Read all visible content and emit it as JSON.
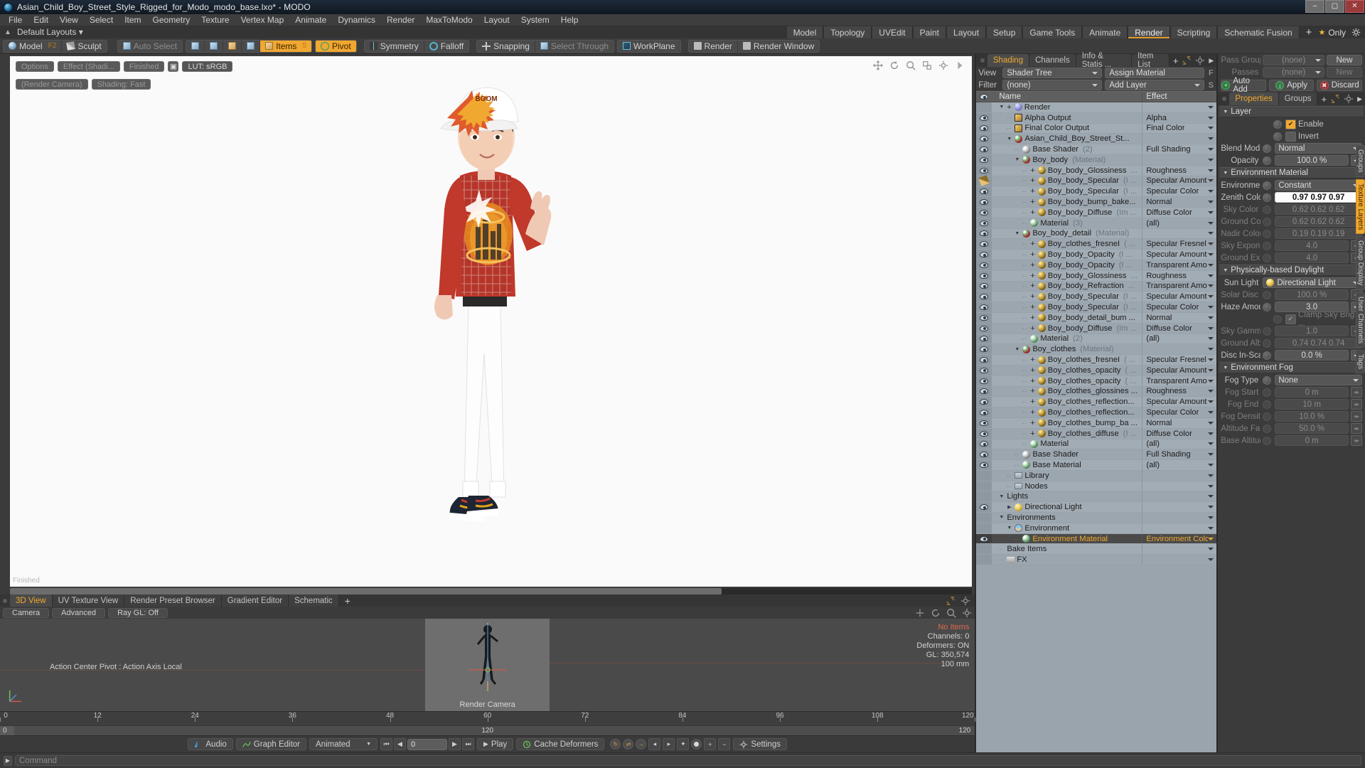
{
  "window": {
    "title": "Asian_Child_Boy_Street_Style_Rigged_for_Modo_modo_base.lxo* - MODO",
    "app_icon": "modo-logo-icon",
    "minimize": "–",
    "maximize": "▢",
    "close": "✕"
  },
  "menu": [
    "File",
    "Edit",
    "View",
    "Select",
    "Item",
    "Geometry",
    "Texture",
    "Vertex Map",
    "Animate",
    "Dynamics",
    "Render",
    "MaxToModo",
    "Layout",
    "System",
    "Help"
  ],
  "layout_row": {
    "pin_icon": "pin-icon",
    "layouts_label": "Default Layouts",
    "tabs": [
      "Model",
      "Topology",
      "UVEdit",
      "Paint",
      "Layout",
      "Setup",
      "Game Tools",
      "Animate",
      "Render",
      "Scripting",
      "Schematic Fusion"
    ],
    "active_tab": "Render",
    "add_tab": "+",
    "only_label": "Only",
    "gear_icon": "gear-icon",
    "star_icon": "star-icon"
  },
  "modebar": {
    "model_label": "Model",
    "model_key": "F2",
    "sculpt_label": "Sculpt",
    "auto_select": "Auto Select",
    "component_icons": [
      "vertex-icon",
      "edge-icon",
      "polygon-icon",
      "item-icon"
    ],
    "items_label": "Items",
    "items_count": "5",
    "pivot_label": "Pivot",
    "symmetry_label": "Symmetry",
    "falloff_label": "Falloff",
    "snapping_label": "Snapping",
    "select_through_label": "Select Through",
    "workplane_label": "WorkPlane",
    "render_label": "Render",
    "render_window_label": "Render Window"
  },
  "viewport": {
    "chips": [
      "Options",
      "Effect (Shadi...",
      "Finished"
    ],
    "lut_label": "LUT: sRGB",
    "camera_label": "(Render Camera)",
    "shading_label": "Shading: Fast",
    "status_left": "Finished",
    "status_right": "",
    "tool_icons": [
      "pan-icon",
      "rotate-icon",
      "zoom-icon",
      "fit-icon",
      "gear-icon",
      "expand-icon"
    ]
  },
  "left_tabs": {
    "items": [
      "3D View",
      "UV Texture View",
      "Render Preset Browser",
      "Gradient Editor",
      "Schematic"
    ],
    "active": "3D View",
    "add": "+"
  },
  "view3d": {
    "buttons": [
      "Camera",
      "Advanced",
      "Ray GL: Off"
    ],
    "tool_icons": [
      "move-icon",
      "rotate-icon",
      "zoom-icon",
      "gear-icon"
    ],
    "action_center": "Action Center Pivot : Action Axis Local",
    "render_camera_label": "Render Camera",
    "stats": {
      "no_items": "No Items",
      "channels": "Channels: 0",
      "deformers": "Deformers: ON",
      "gl": "GL: 350,574",
      "units": "100 mm"
    }
  },
  "timeline": {
    "ticks": [
      0,
      12,
      24,
      36,
      48,
      60,
      72,
      84,
      96,
      108,
      120
    ],
    "range_start": "0",
    "range_mid": "120",
    "range_end": "120"
  },
  "transport": {
    "audio_label": "Audio",
    "graph_editor_label": "Graph Editor",
    "animated_label": "Animated",
    "frame_value": "0",
    "play_label": "Play",
    "cache_deformers_label": "Cache Deformers",
    "settings_label": "Settings",
    "icons": [
      "audio-icon",
      "graph-editor-icon",
      "first-frame-icon",
      "prev-key-icon",
      "next-key-icon",
      "last-frame-icon",
      "play-icon",
      "cache-icon",
      "settings-icon"
    ]
  },
  "shading_panel": {
    "tabs": [
      "Shading",
      "Channels",
      "Info & Statis ...",
      "Item List"
    ],
    "active_tab": "Shading",
    "add_tab": "+",
    "view_label": "View",
    "view_value": "Shader Tree",
    "assign_material": "Assign Material",
    "assign_flag": "F",
    "filter_label": "Filter",
    "filter_value": "(none)",
    "add_layer": "Add Layer",
    "add_layer_flag": "S",
    "columns": {
      "eye": "eye-icon",
      "name": "Name",
      "effect": "Effect"
    },
    "rows": [
      {
        "indent": 0,
        "eye": false,
        "twist": "▼",
        "plus": "+",
        "icon": "render",
        "name": "Render",
        "muted": "",
        "effect": "",
        "selected": false
      },
      {
        "indent": 1,
        "eye": true,
        "twist": "",
        "plus": "",
        "icon": "out",
        "name": "Alpha Output",
        "muted": "",
        "effect": "Alpha",
        "selected": false
      },
      {
        "indent": 1,
        "eye": true,
        "twist": "",
        "plus": "",
        "icon": "out",
        "name": "Final Color Output",
        "muted": "",
        "effect": "Final Color",
        "selected": false
      },
      {
        "indent": 1,
        "eye": true,
        "twist": "▼",
        "plus": "",
        "icon": "matball red",
        "name": "Asian_Child_Boy_Street_St...",
        "muted": "",
        "effect": "",
        "selected": false
      },
      {
        "indent": 2,
        "eye": true,
        "twist": "",
        "plus": "",
        "icon": "matball grey",
        "name": "Base Shader",
        "muted": "(2)",
        "effect": "Full Shading",
        "selected": false
      },
      {
        "indent": 2,
        "eye": true,
        "twist": "▼",
        "plus": "",
        "icon": "matball red",
        "name": "Boy_body",
        "muted": "(Material)",
        "effect": "",
        "selected": false
      },
      {
        "indent": 3,
        "eye": true,
        "twist": "",
        "plus": "+",
        "icon": "tex",
        "name": "Boy_body_Glossiness",
        "muted": "...",
        "effect": "Roughness",
        "selected": false
      },
      {
        "indent": 3,
        "eye": "brush",
        "twist": "",
        "plus": "+",
        "icon": "tex",
        "name": "Boy_body_Specular",
        "muted": "(I ...",
        "effect": "Specular Amount",
        "selected": false
      },
      {
        "indent": 3,
        "eye": true,
        "twist": "",
        "plus": "+",
        "icon": "tex",
        "name": "Boy_body_Specular",
        "muted": "(I ...",
        "effect": "Specular Color",
        "selected": false
      },
      {
        "indent": 3,
        "eye": true,
        "twist": "",
        "plus": "+",
        "icon": "tex",
        "name": "Boy_body_bump_bake...",
        "muted": "",
        "effect": "Normal",
        "selected": false
      },
      {
        "indent": 3,
        "eye": true,
        "twist": "",
        "plus": "+",
        "icon": "tex",
        "name": "Boy_body_Diffuse",
        "muted": "(Im ...",
        "effect": "Diffuse Color",
        "selected": false
      },
      {
        "indent": 3,
        "eye": true,
        "twist": "",
        "plus": "",
        "icon": "matball green",
        "name": "Material",
        "muted": "(3)",
        "effect": "(all)",
        "selected": false
      },
      {
        "indent": 2,
        "eye": true,
        "twist": "▼",
        "plus": "",
        "icon": "matball red",
        "name": "Boy_body_detail",
        "muted": "(Material)",
        "effect": "",
        "selected": false
      },
      {
        "indent": 3,
        "eye": true,
        "twist": "",
        "plus": "+",
        "icon": "tex",
        "name": "Boy_clothes_fresneI",
        "muted": "( ...",
        "effect": "Specular Fresnel",
        "selected": false
      },
      {
        "indent": 3,
        "eye": true,
        "twist": "",
        "plus": "+",
        "icon": "tex",
        "name": "Boy_body_Opacity",
        "muted": "(I ...",
        "effect": "Specular Amount",
        "selected": false
      },
      {
        "indent": 3,
        "eye": true,
        "twist": "",
        "plus": "+",
        "icon": "tex",
        "name": "Boy_body_Opacity",
        "muted": "(I ...",
        "effect": "Transparent Amo ...",
        "selected": false
      },
      {
        "indent": 3,
        "eye": true,
        "twist": "",
        "plus": "+",
        "icon": "tex",
        "name": "Boy_body_Glossiness",
        "muted": "...",
        "effect": "Roughness",
        "selected": false
      },
      {
        "indent": 3,
        "eye": true,
        "twist": "",
        "plus": "+",
        "icon": "tex",
        "name": "Boy_body_Refraction",
        "muted": "...",
        "effect": "Transparent Amo ...",
        "selected": false
      },
      {
        "indent": 3,
        "eye": true,
        "twist": "",
        "plus": "+",
        "icon": "tex",
        "name": "Boy_body_Specular",
        "muted": "(I ...",
        "effect": "Specular Amount",
        "selected": false
      },
      {
        "indent": 3,
        "eye": true,
        "twist": "",
        "plus": "+",
        "icon": "tex",
        "name": "Boy_body_Specular",
        "muted": "(I ...",
        "effect": "Specular Color",
        "selected": false
      },
      {
        "indent": 3,
        "eye": true,
        "twist": "",
        "plus": "+",
        "icon": "tex",
        "name": "Boy_body_detail_bum ...",
        "muted": "",
        "effect": "Normal",
        "selected": false
      },
      {
        "indent": 3,
        "eye": true,
        "twist": "",
        "plus": "+",
        "icon": "tex",
        "name": "Boy_body_Diffuse",
        "muted": "(Im ...",
        "effect": "Diffuse Color",
        "selected": false
      },
      {
        "indent": 3,
        "eye": true,
        "twist": "",
        "plus": "",
        "icon": "matball green",
        "name": "Material",
        "muted": "(2)",
        "effect": "(all)",
        "selected": false
      },
      {
        "indent": 2,
        "eye": true,
        "twist": "▼",
        "plus": "",
        "icon": "matball red",
        "name": "Boy_clothes",
        "muted": "(Material)",
        "effect": "",
        "selected": false
      },
      {
        "indent": 3,
        "eye": true,
        "twist": "",
        "plus": "+",
        "icon": "tex",
        "name": "Boy_clothes_fresneI",
        "muted": "( ...",
        "effect": "Specular Fresnel",
        "selected": false
      },
      {
        "indent": 3,
        "eye": true,
        "twist": "",
        "plus": "+",
        "icon": "tex",
        "name": "Boy_clothes_opacity",
        "muted": "( ...",
        "effect": "Specular Amount",
        "selected": false
      },
      {
        "indent": 3,
        "eye": true,
        "twist": "",
        "plus": "+",
        "icon": "tex",
        "name": "Boy_clothes_opacity",
        "muted": "( ...",
        "effect": "Transparent Amo ...",
        "selected": false
      },
      {
        "indent": 3,
        "eye": true,
        "twist": "",
        "plus": "+",
        "icon": "tex",
        "name": "Boy_clothes_glossines ...",
        "muted": "",
        "effect": "Roughness",
        "selected": false
      },
      {
        "indent": 3,
        "eye": true,
        "twist": "",
        "plus": "+",
        "icon": "tex",
        "name": "Boy_clothes_reflection...",
        "muted": "",
        "effect": "Specular Amount",
        "selected": false
      },
      {
        "indent": 3,
        "eye": true,
        "twist": "",
        "plus": "+",
        "icon": "tex",
        "name": "Boy_clothes_reflection...",
        "muted": "",
        "effect": "Specular Color",
        "selected": false
      },
      {
        "indent": 3,
        "eye": true,
        "twist": "",
        "plus": "+",
        "icon": "tex",
        "name": "Boy_clothes_bump_ba ...",
        "muted": "",
        "effect": "Normal",
        "selected": false
      },
      {
        "indent": 3,
        "eye": true,
        "twist": "",
        "plus": "+",
        "icon": "tex",
        "name": "Boy_clothes_diffuse",
        "muted": "(I ...",
        "effect": "Diffuse Color",
        "selected": false
      },
      {
        "indent": 3,
        "eye": true,
        "twist": "",
        "plus": "",
        "icon": "matball green",
        "name": "Material",
        "muted": "",
        "effect": "(all)",
        "selected": false
      },
      {
        "indent": 2,
        "eye": true,
        "twist": "",
        "plus": "",
        "icon": "matball grey",
        "name": "Base Shader",
        "muted": "",
        "effect": "Full Shading",
        "selected": false
      },
      {
        "indent": 2,
        "eye": true,
        "twist": "",
        "plus": "",
        "icon": "matball green",
        "name": "Base Material",
        "muted": "",
        "effect": "(all)",
        "selected": false
      },
      {
        "indent": 1,
        "eye": false,
        "twist": "",
        "plus": "",
        "icon": "folder",
        "name": "Library",
        "muted": "",
        "effect": "",
        "selected": false
      },
      {
        "indent": 1,
        "eye": false,
        "twist": "",
        "plus": "",
        "icon": "folder",
        "name": "Nodes",
        "muted": "",
        "effect": "",
        "selected": false
      },
      {
        "indent": 0,
        "eye": false,
        "twist": "▼",
        "plus": "",
        "icon": "",
        "name": "Lights",
        "muted": "",
        "effect": "",
        "selected": false
      },
      {
        "indent": 1,
        "eye": true,
        "twist": "▶",
        "plus": "",
        "icon": "light",
        "name": "Directional Light",
        "muted": "",
        "effect": "",
        "selected": false
      },
      {
        "indent": 0,
        "eye": false,
        "twist": "▼",
        "plus": "",
        "icon": "",
        "name": "Environments",
        "muted": "",
        "effect": "",
        "selected": false
      },
      {
        "indent": 1,
        "eye": false,
        "twist": "▼",
        "plus": "",
        "icon": "env",
        "name": "Environment",
        "muted": "",
        "effect": "",
        "selected": false
      },
      {
        "indent": 2,
        "eye": true,
        "twist": "",
        "plus": "",
        "icon": "matball green",
        "name": "Environment Material",
        "muted": "",
        "effect": "Environment Color",
        "selected": true
      },
      {
        "indent": 0,
        "eye": false,
        "twist": "",
        "plus": "",
        "icon": "",
        "name": "Bake Items",
        "muted": "",
        "effect": "",
        "selected": false
      },
      {
        "indent": 0,
        "eye": false,
        "twist": "",
        "plus": "",
        "icon": "fx",
        "name": "FX",
        "muted": "",
        "effect": "",
        "selected": false
      }
    ]
  },
  "properties_panel": {
    "pass_groups_label": "Pass Groups",
    "pass_groups_value": "(none)",
    "pass_groups_new": "New",
    "passes_label": "Passes",
    "passes_value": "(none)",
    "passes_new": "New",
    "auto_add": "Auto Add",
    "apply": "Apply",
    "discard": "Discard",
    "tabs": [
      "Properties",
      "Groups"
    ],
    "active_tab": "Properties",
    "add_tab": "+",
    "gear_icon": "gear-icon",
    "expand_icon": "expand-icon",
    "sections": {
      "layer": {
        "title": "Layer",
        "enable_label": "Enable",
        "enable_checked": true,
        "invert_label": "Invert",
        "invert_checked": false,
        "blend_mode_label": "Blend Mode",
        "blend_mode_value": "Normal",
        "opacity_label": "Opacity",
        "opacity_value": "100.0 %"
      },
      "environment_material": {
        "title": "Environment Material",
        "rows": [
          {
            "label": "Environment...",
            "value": "Constant",
            "type": "select",
            "dim": false
          },
          {
            "label": "Zenith Color",
            "value": "0.97 0.97 0.97",
            "type": "color",
            "dim": false
          },
          {
            "label": "Sky Color",
            "value": "0.62 0.62 0.62",
            "type": "color",
            "dim": true
          },
          {
            "label": "Ground Color",
            "value": "0.62 0.62 0.62",
            "type": "color",
            "dim": true
          },
          {
            "label": "Nadir Color",
            "value": "0.19 0.19 0.19",
            "type": "color",
            "dim": true
          },
          {
            "label": "Sky Exponent",
            "value": "4.0",
            "type": "stepper",
            "dim": true
          },
          {
            "label": "Ground Exp ...",
            "value": "4.0",
            "type": "stepper",
            "dim": true
          }
        ]
      },
      "daylight": {
        "title": "Physically-based Daylight",
        "sun_light_label": "Sun Light",
        "sun_light_value": "Directional Light",
        "rows": [
          {
            "label": "Solar Disc Size",
            "value": "100.0 %",
            "type": "stepper",
            "dim": true
          },
          {
            "label": "Haze Amount",
            "value": "3.0",
            "type": "stepper",
            "dim": false
          }
        ],
        "clamp_label": "Clamp Sky Brig ...",
        "clamp_checked": true,
        "rows2": [
          {
            "label": "Sky Gamma",
            "value": "1.0",
            "type": "stepper",
            "dim": true
          },
          {
            "label": "Ground Albedo",
            "value": "0.74 0.74 0.74",
            "type": "color",
            "dim": true
          },
          {
            "label": "Disc In-Scatter",
            "value": "0.0 %",
            "type": "stepper",
            "dim": false
          }
        ]
      },
      "environment_fog": {
        "title": "Environment Fog",
        "rows": [
          {
            "label": "Fog Type",
            "value": "None",
            "type": "select",
            "dim": false
          },
          {
            "label": "Fog Start",
            "value": "0 m",
            "type": "stepper",
            "dim": true
          },
          {
            "label": "Fog End",
            "value": "10 m",
            "type": "stepper",
            "dim": true
          },
          {
            "label": "Fog Density",
            "value": "10.0 %",
            "type": "stepper",
            "dim": true
          },
          {
            "label": "Altitude Falloff",
            "value": "50.0 %",
            "type": "stepper",
            "dim": true
          },
          {
            "label": "Base Altitude",
            "value": "0 m",
            "type": "stepper",
            "dim": true
          }
        ]
      }
    },
    "side_tabs": [
      "Groups",
      "Texture Layers",
      "Group Display",
      "User Channels",
      "Tags"
    ],
    "side_tab_active": "Texture Layers"
  },
  "command_bar": {
    "placeholder": "Command",
    "arrow_icon": "chevron-right-icon"
  },
  "colors": {
    "accent": "#f0a830",
    "panel_bg": "#3b3b3b",
    "tree_bg": "#a2acb4",
    "titlebar": "#152030"
  }
}
